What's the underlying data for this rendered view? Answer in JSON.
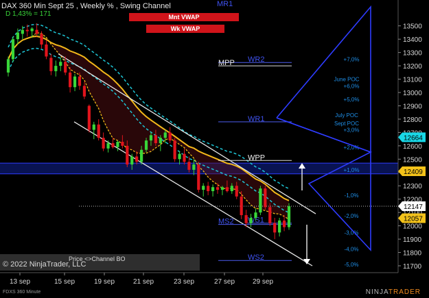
{
  "header": {
    "title": "DAX 360 Min Sept 25 , Weekly % , Swing Channel",
    "subtitle": "D 1,43% = 171"
  },
  "buttons": {
    "monthly_vwap": "Mnt VWAP",
    "weekly_vwap": "Wk VWAP"
  },
  "footer": {
    "instrument_label": "FDXS 360 Minute",
    "copyright": "© 2022 NinjaTrader, LLC",
    "logo_prefix": "NINJA",
    "logo_suffix": "TRADER",
    "panel_note": "Price <>Channel BO"
  },
  "colors": {
    "up": "#39d639",
    "down": "#e0141c",
    "ma_fast": "#f3b81a",
    "ma_slow": "#f3b81a",
    "bands": "#1ec8d8",
    "channel": "#e8e8e8",
    "pivot_blue": "#2e3cff",
    "label_blue": "#1f8fe8"
  },
  "chart_data": {
    "type": "candlestick",
    "title": "DAX 360 Min Sept 25 , Weekly % , Swing Channel",
    "x_tick_labels": [
      "13 sep",
      "15 sep",
      "19 sep",
      "21 sep",
      "23 sep",
      "27 sep",
      "29 sep"
    ],
    "y_axis": {
      "min": 11700,
      "max": 13550,
      "ticks": [
        11700,
        11800,
        11900,
        12000,
        12100,
        12200,
        12300,
        12400,
        12500,
        12600,
        12700,
        12800,
        12900,
        13000,
        13100,
        13200,
        13300,
        13400,
        13500
      ]
    },
    "price_markers": [
      {
        "value": 12664,
        "label": "12664",
        "style": "cyan"
      },
      {
        "value": 12409,
        "label": "12409",
        "style": "yellow"
      },
      {
        "value": 12147,
        "label": "12147",
        "style": "white"
      },
      {
        "value": 12057,
        "label": "12057",
        "style": "yellow"
      }
    ],
    "levels": [
      {
        "name": "MR1",
        "value": 13560
      },
      {
        "name": "WR2",
        "value": 13225
      },
      {
        "name": "MPP",
        "value": 13200
      },
      {
        "name": "WR1",
        "value": 12780
      },
      {
        "name": "WPP",
        "value": 12490
      },
      {
        "name": "WS1",
        "value": 12020
      },
      {
        "name": "MS2",
        "value": 12010
      },
      {
        "name": "WS2",
        "value": 11740
      }
    ],
    "percent_levels": [
      {
        "label": "+7,0%",
        "value": 13250
      },
      {
        "label": "+6,0%",
        "value": 13050
      },
      {
        "label": "+5,0%",
        "value": 12950
      },
      {
        "label": "+3,0%",
        "value": 12720
      },
      {
        "label": "+2,0%",
        "value": 12590
      },
      {
        "label": "+1,0%",
        "value": 12420
      },
      {
        "label": "-1,0%",
        "value": 12230
      },
      {
        "label": "-2,0%",
        "value": 12075
      },
      {
        "label": "-3,0%",
        "value": 11950
      },
      {
        "label": "-4,0%",
        "value": 11825
      },
      {
        "label": "-5,0%",
        "value": 11710
      }
    ],
    "poc_labels": [
      {
        "label": "June POC",
        "value": 13100
      },
      {
        "label": "July POC",
        "value": 12830
      },
      {
        "label": "Sept POC",
        "value": 12770
      }
    ],
    "candles": [
      {
        "o": 13150,
        "h": 13270,
        "l": 13120,
        "c": 13250
      },
      {
        "o": 13250,
        "h": 13420,
        "l": 13230,
        "c": 13400
      },
      {
        "o": 13400,
        "h": 13480,
        "l": 13360,
        "c": 13450
      },
      {
        "o": 13440,
        "h": 13500,
        "l": 13400,
        "c": 13470
      },
      {
        "o": 13470,
        "h": 13510,
        "l": 13420,
        "c": 13460
      },
      {
        "o": 13460,
        "h": 13490,
        "l": 13410,
        "c": 13480
      },
      {
        "o": 13470,
        "h": 13520,
        "l": 13420,
        "c": 13440
      },
      {
        "o": 13440,
        "h": 13460,
        "l": 13330,
        "c": 13360
      },
      {
        "o": 13360,
        "h": 13390,
        "l": 13250,
        "c": 13270
      },
      {
        "o": 13260,
        "h": 13290,
        "l": 13130,
        "c": 13160
      },
      {
        "o": 13160,
        "h": 13240,
        "l": 13120,
        "c": 13200
      },
      {
        "o": 13200,
        "h": 13260,
        "l": 13160,
        "c": 13230
      },
      {
        "o": 13230,
        "h": 13270,
        "l": 13130,
        "c": 13150
      },
      {
        "o": 13150,
        "h": 13190,
        "l": 13000,
        "c": 13040
      },
      {
        "o": 13040,
        "h": 13140,
        "l": 13010,
        "c": 13120
      },
      {
        "o": 13120,
        "h": 13150,
        "l": 13020,
        "c": 13050
      },
      {
        "o": 13050,
        "h": 13080,
        "l": 12950,
        "c": 12970
      },
      {
        "o": 12900,
        "h": 12910,
        "l": 12700,
        "c": 12720
      },
      {
        "o": 12720,
        "h": 12780,
        "l": 12650,
        "c": 12760
      },
      {
        "o": 12760,
        "h": 12800,
        "l": 12640,
        "c": 12660
      },
      {
        "o": 12660,
        "h": 12700,
        "l": 12560,
        "c": 12580
      },
      {
        "o": 12580,
        "h": 12640,
        "l": 12550,
        "c": 12620
      },
      {
        "o": 12620,
        "h": 12660,
        "l": 12580,
        "c": 12590
      },
      {
        "o": 12590,
        "h": 12640,
        "l": 12560,
        "c": 12630
      },
      {
        "o": 12630,
        "h": 12680,
        "l": 12580,
        "c": 12600
      },
      {
        "o": 12600,
        "h": 12640,
        "l": 12440,
        "c": 12460
      },
      {
        "o": 12460,
        "h": 12540,
        "l": 12420,
        "c": 12520
      },
      {
        "o": 12520,
        "h": 12560,
        "l": 12460,
        "c": 12480
      },
      {
        "o": 12480,
        "h": 12600,
        "l": 12460,
        "c": 12570
      },
      {
        "o": 12570,
        "h": 12660,
        "l": 12550,
        "c": 12640
      },
      {
        "o": 12640,
        "h": 12700,
        "l": 12600,
        "c": 12680
      },
      {
        "o": 12680,
        "h": 12720,
        "l": 12600,
        "c": 12620
      },
      {
        "o": 12620,
        "h": 12680,
        "l": 12560,
        "c": 12660
      },
      {
        "o": 12660,
        "h": 12720,
        "l": 12620,
        "c": 12700
      },
      {
        "o": 12700,
        "h": 12740,
        "l": 12620,
        "c": 12640
      },
      {
        "o": 12640,
        "h": 12660,
        "l": 12480,
        "c": 12500
      },
      {
        "o": 12500,
        "h": 12560,
        "l": 12460,
        "c": 12540
      },
      {
        "o": 12540,
        "h": 12580,
        "l": 12460,
        "c": 12480
      },
      {
        "o": 12480,
        "h": 12520,
        "l": 12400,
        "c": 12420
      },
      {
        "o": 12420,
        "h": 12500,
        "l": 12380,
        "c": 12460
      },
      {
        "o": 12460,
        "h": 12480,
        "l": 12250,
        "c": 12270
      },
      {
        "o": 12270,
        "h": 12320,
        "l": 12220,
        "c": 12300
      },
      {
        "o": 12300,
        "h": 12330,
        "l": 12230,
        "c": 12260
      },
      {
        "o": 12260,
        "h": 12310,
        "l": 12220,
        "c": 12290
      },
      {
        "o": 12290,
        "h": 12320,
        "l": 12240,
        "c": 12270
      },
      {
        "o": 12270,
        "h": 12300,
        "l": 12230,
        "c": 12290
      },
      {
        "o": 12290,
        "h": 12340,
        "l": 12250,
        "c": 12260
      },
      {
        "o": 12260,
        "h": 12320,
        "l": 12240,
        "c": 12300
      },
      {
        "o": 12300,
        "h": 12330,
        "l": 12200,
        "c": 12220
      },
      {
        "o": 12220,
        "h": 12260,
        "l": 12050,
        "c": 12080
      },
      {
        "o": 12080,
        "h": 12120,
        "l": 11990,
        "c": 12020
      },
      {
        "o": 12020,
        "h": 12090,
        "l": 11990,
        "c": 12060
      },
      {
        "o": 12060,
        "h": 12130,
        "l": 12040,
        "c": 12100
      },
      {
        "o": 12100,
        "h": 12300,
        "l": 12080,
        "c": 12280
      },
      {
        "o": 12280,
        "h": 12300,
        "l": 12120,
        "c": 12140
      },
      {
        "o": 12140,
        "h": 12170,
        "l": 12000,
        "c": 12020
      },
      {
        "o": 12020,
        "h": 12060,
        "l": 11900,
        "c": 11950
      },
      {
        "o": 11950,
        "h": 12060,
        "l": 11920,
        "c": 12040
      },
      {
        "o": 12040,
        "h": 12080,
        "l": 11960,
        "c": 11990
      },
      {
        "o": 11990,
        "h": 12170,
        "l": 11970,
        "c": 12147
      }
    ]
  }
}
